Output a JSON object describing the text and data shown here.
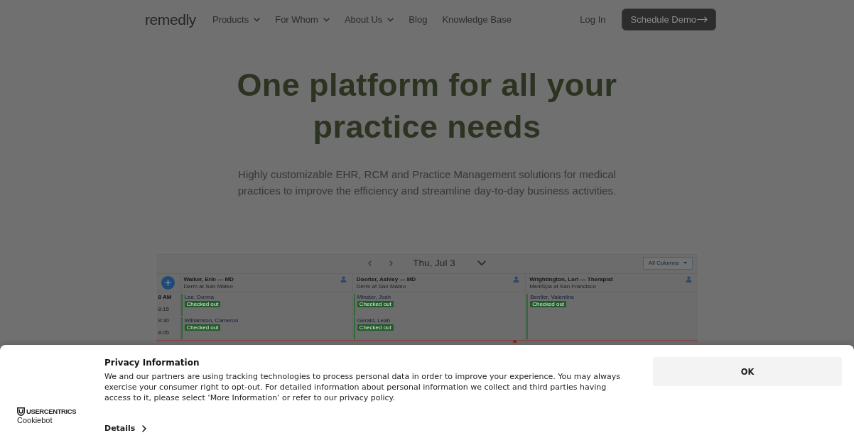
{
  "nav": {
    "logo": "remedly",
    "items": [
      {
        "label": "Products",
        "dropdown": true
      },
      {
        "label": "For Whom",
        "dropdown": true
      },
      {
        "label": "About Us",
        "dropdown": true
      },
      {
        "label": "Blog",
        "dropdown": false
      },
      {
        "label": "Knowledge Base",
        "dropdown": false
      }
    ],
    "login": "Log In",
    "cta": "Schedule Demo"
  },
  "hero": {
    "title": "One platform for all your practice needs",
    "subtitle": "Highly customizable EHR, RCM and Practice Management solutions for medical practices to improve the efficiency and streamline day-to-day business activities."
  },
  "schedule_preview": {
    "date": "Thu, Jul 3",
    "filter": "All Columns",
    "times": [
      "8 AM",
      "8:15",
      "8:30",
      "8:45"
    ],
    "providers": [
      {
        "name": "Walker, Erin — MD",
        "location": "Derm at San Mateo",
        "appointments": [
          {
            "patient": "Lee, Donna",
            "status": "Checked out"
          },
          {
            "patient": "Williamson, Cameron",
            "status": "Checked out"
          }
        ]
      },
      {
        "name": "Doerter, Ashley — MD",
        "location": "Derm at San Mateo",
        "appointments": [
          {
            "patient": "Minster, Josh",
            "status": "Checked out"
          },
          {
            "patient": "Gerald, Leah",
            "status": "Checked out"
          }
        ]
      },
      {
        "name": "Wrightington, Lori — Therapist",
        "location": "MediSpa at San Francisco",
        "appointments": [
          {
            "patient": "Bentler, Valentine",
            "status": "Checked out"
          }
        ]
      }
    ]
  },
  "cookie_banner": {
    "brand": "USERCENTRICS",
    "product": "Cookiebot",
    "title": "Privacy Information",
    "text": "We and our partners are using tracking technologies to process personal data in order to improve your experience. You may always exercise your consumer right to opt-out. For detailed information about personal information we collect and third parties having access to it, please select ‘More Information’ or refer to our privacy policy.",
    "details": "Details",
    "ok": "OK"
  }
}
